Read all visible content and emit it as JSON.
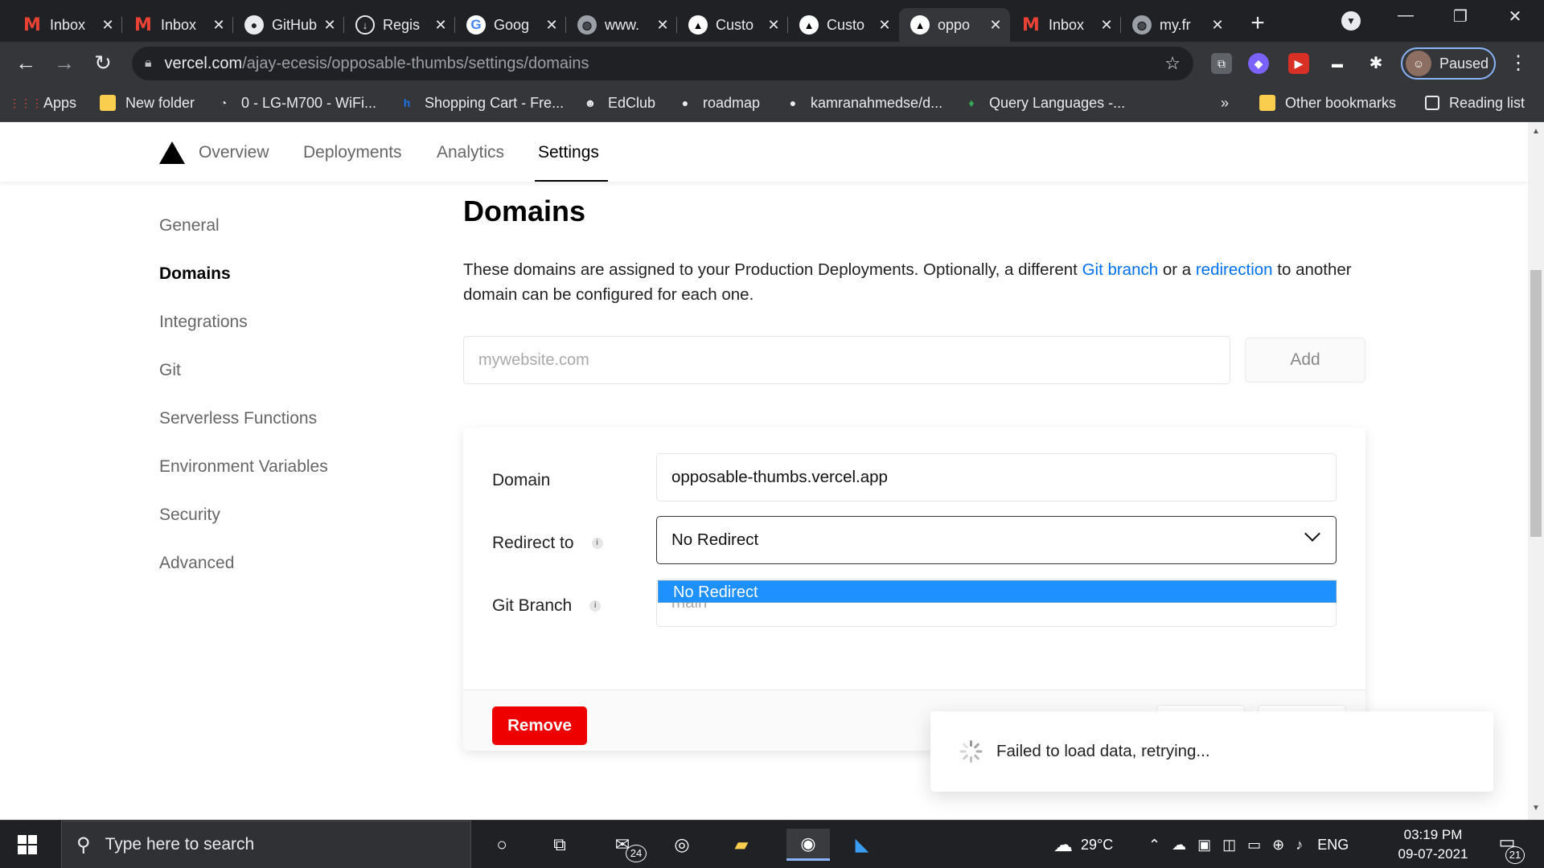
{
  "browser": {
    "tabs": [
      {
        "title": "Inbox",
        "icon": "gmail-icon",
        "active": false
      },
      {
        "title": "Inbox",
        "icon": "gmail-icon",
        "active": false
      },
      {
        "title": "GitHub",
        "icon": "github-icon",
        "active": false
      },
      {
        "title": "Regis",
        "icon": "download-icon",
        "active": false
      },
      {
        "title": "Goog",
        "icon": "google-icon",
        "active": false
      },
      {
        "title": "www.",
        "icon": "globe-icon",
        "active": false
      },
      {
        "title": "Custo",
        "icon": "vercel-icon",
        "active": false
      },
      {
        "title": "Custo",
        "icon": "vercel-icon",
        "active": false
      },
      {
        "title": "oppo",
        "icon": "vercel-icon",
        "active": true
      },
      {
        "title": "Inbox",
        "icon": "gmail-icon",
        "active": false
      },
      {
        "title": "my.fr",
        "icon": "globe-icon",
        "active": false
      }
    ],
    "url_host": "vercel.com",
    "url_path": "/ajay-ecesis/opposable-thumbs/settings/domains",
    "profile_label": "Paused",
    "bookmarks": [
      {
        "label": "Apps",
        "icon": "apps-grid-icon"
      },
      {
        "label": "New folder",
        "icon": "folder-icon"
      },
      {
        "label": "0 - LG-M700 - WiFi...",
        "icon": "wifi-icon"
      },
      {
        "label": "Shopping Cart - Fre...",
        "icon": "shopping-icon"
      },
      {
        "label": "EdClub",
        "icon": "edclub-icon"
      },
      {
        "label": "roadmap",
        "icon": "github-icon"
      },
      {
        "label": "kamranahmedse/d...",
        "icon": "github-icon"
      },
      {
        "label": "Query Languages -...",
        "icon": "leaf-icon"
      }
    ],
    "bookmarks_overflow": "»",
    "other_bookmarks": "Other bookmarks",
    "reading_list": "Reading list"
  },
  "topnav": {
    "items": [
      "Overview",
      "Deployments",
      "Analytics",
      "Settings"
    ],
    "active": "Settings"
  },
  "sidebar": {
    "items": [
      "General",
      "Domains",
      "Integrations",
      "Git",
      "Serverless Functions",
      "Environment Variables",
      "Security",
      "Advanced"
    ],
    "active": "Domains"
  },
  "main": {
    "title": "Domains",
    "desc_part1": "These domains are assigned to your Production Deployments. Optionally, a different ",
    "desc_link1": "Git branch",
    "desc_part2": " or a ",
    "desc_link2": "redirection",
    "desc_part3": " to another domain can be configured for each one.",
    "add_placeholder": "mywebsite.com",
    "add_button": "Add",
    "card": {
      "domain_label": "Domain",
      "domain_value": "opposable-thumbs.vercel.app",
      "redirect_label": "Redirect to",
      "redirect_value": "No Redirect",
      "redirect_options": [
        "No Redirect"
      ],
      "git_label": "Git Branch",
      "git_placeholder": "main",
      "remove_button": "Remove"
    }
  },
  "toast": {
    "message": "Failed to load data, retrying..."
  },
  "taskbar": {
    "search_placeholder": "Type here to search",
    "mail_badge": "24",
    "weather": "29°C",
    "language": "ENG",
    "time": "03:19 PM",
    "date": "09-07-2021",
    "notifications": "21"
  }
}
